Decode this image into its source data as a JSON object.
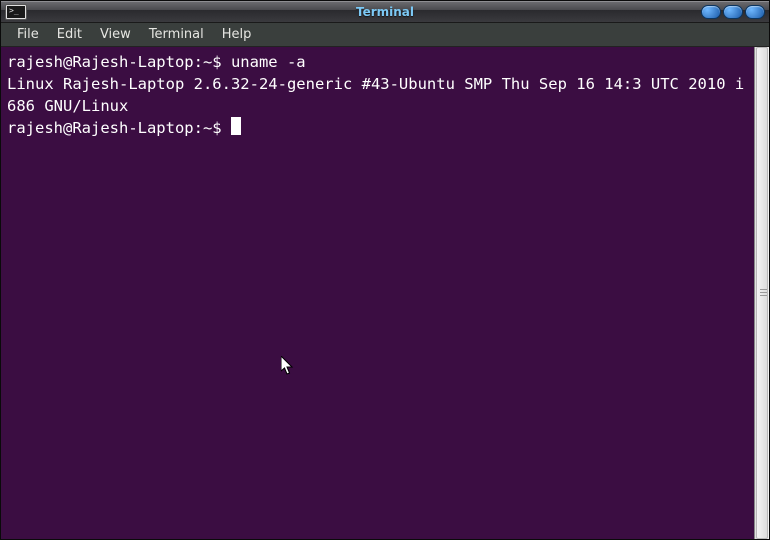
{
  "window": {
    "title": "Terminal",
    "controls": {
      "minimize": "minimize",
      "maximize": "maximize",
      "close": "close"
    }
  },
  "menubar": {
    "items": [
      "File",
      "Edit",
      "View",
      "Terminal",
      "Help"
    ]
  },
  "terminal": {
    "prompt": "rajesh@Rajesh-Laptop:~$ ",
    "command": "uname -a",
    "output": "Linux Rajesh-Laptop 2.6.32-24-generic #43-Ubuntu SMP Thu Sep 16 14:3 UTC 2010 i686 GNU/Linux",
    "prompt2": "rajesh@Rajesh-Laptop:~$ "
  },
  "colors": {
    "term_bg": "#3b0d42",
    "term_fg": "#ffffff",
    "titlebar_accent": "#7cc9f5"
  }
}
